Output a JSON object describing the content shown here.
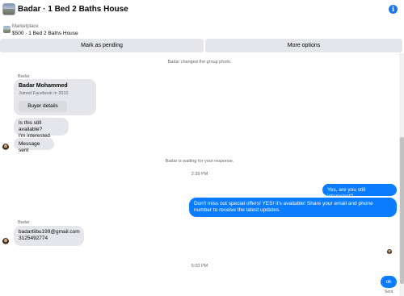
{
  "header": {
    "title": "Badar · 1 Bed 2 Baths House",
    "info_icon": "info-icon"
  },
  "marketplace": {
    "label": "Marketplace",
    "listing": "$500 · 1 Bed 2 Baths House"
  },
  "actions": {
    "mark_pending": "Mark as pending",
    "more_options": "More options"
  },
  "conversation": {
    "system_photo": "Badar changed the group photo.",
    "sender_1": "Badar",
    "card": {
      "name": "Badar Mohammed",
      "joined": "Joined Facebook in 2010",
      "button": "Buyer details"
    },
    "msg_available": "Is this still available?",
    "msg_interested": "I'm interested",
    "msg_sent": "Message sent",
    "system_waiting": "Badar is waiting for your response.",
    "time_1": "2:39 PM",
    "out_1": "Yes, are you still interested?",
    "out_2": "Don't miss out special offers! YES! it's available! Share your email and phone number to receive the latest updates.",
    "sender_2": "Badar",
    "in_email": "badartiibu199@gmail.com",
    "in_phone": "3125492774",
    "time_2": "5:03 PM",
    "out_ok": "ok",
    "sent_status": "Sent"
  },
  "colors": {
    "accent_blue": "#0a7cff",
    "bubble_grey": "#e4e6eb",
    "muted_text": "#65676b"
  }
}
